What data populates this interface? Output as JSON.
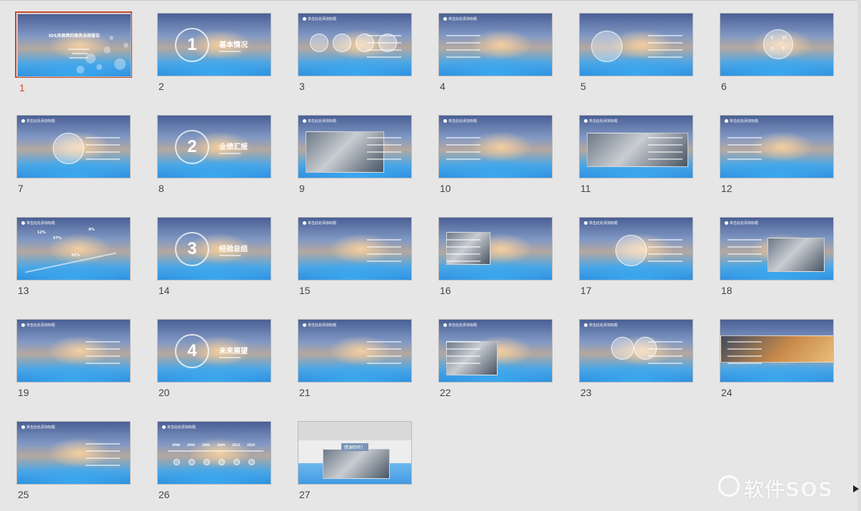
{
  "slides": [
    {
      "number": "1",
      "type": "title",
      "title": "IOS风格简约商务总结报告"
    },
    {
      "number": "2",
      "type": "section",
      "big": "1",
      "title": "基本情况"
    },
    {
      "number": "3",
      "type": "content",
      "header": "单击此处添加标题"
    },
    {
      "number": "4",
      "type": "content",
      "header": "单击此处添加标题"
    },
    {
      "number": "5",
      "type": "content",
      "header": ""
    },
    {
      "number": "6",
      "type": "swot",
      "header": "",
      "letters": [
        "S",
        "W",
        "O",
        "T"
      ]
    },
    {
      "number": "7",
      "type": "content",
      "header": "单击此处添加标题"
    },
    {
      "number": "8",
      "type": "section",
      "big": "2",
      "title": "业绩汇报"
    },
    {
      "number": "9",
      "type": "content",
      "header": "单击此处添加标题"
    },
    {
      "number": "10",
      "type": "content",
      "header": "单击此处添加标题"
    },
    {
      "number": "11",
      "type": "content",
      "header": "单击此处添加标题"
    },
    {
      "number": "12",
      "type": "content",
      "header": "单击此处添加标题"
    },
    {
      "number": "13",
      "type": "stats",
      "header": "单击此处添加标题",
      "values": [
        "12%",
        "37%",
        "8%",
        "55%"
      ]
    },
    {
      "number": "14",
      "type": "section",
      "big": "3",
      "title": "经验总结"
    },
    {
      "number": "15",
      "type": "content",
      "header": "单击此处添加标题"
    },
    {
      "number": "16",
      "type": "content",
      "header": ""
    },
    {
      "number": "17",
      "type": "content",
      "header": "单击此处添加标题"
    },
    {
      "number": "18",
      "type": "content",
      "header": "单击此处添加标题"
    },
    {
      "number": "19",
      "type": "content",
      "header": "单击此处添加标题"
    },
    {
      "number": "20",
      "type": "section",
      "big": "4",
      "title": "未来展望"
    },
    {
      "number": "21",
      "type": "content",
      "header": "单击此处添加标题"
    },
    {
      "number": "22",
      "type": "content",
      "header": "单击此处添加标题"
    },
    {
      "number": "23",
      "type": "content",
      "header": "单击此处添加标题"
    },
    {
      "number": "24",
      "type": "content",
      "header": ""
    },
    {
      "number": "25",
      "type": "content",
      "header": "单击此处添加标题"
    },
    {
      "number": "26",
      "type": "timeline",
      "header": "单击此处添加标题",
      "years": [
        "2000",
        "2003",
        "2006",
        "2009",
        "2012",
        "2015"
      ]
    },
    {
      "number": "27",
      "type": "thanks",
      "title": "感谢聆听！"
    }
  ],
  "selected_slide": "1",
  "watermark": "软件SOS"
}
